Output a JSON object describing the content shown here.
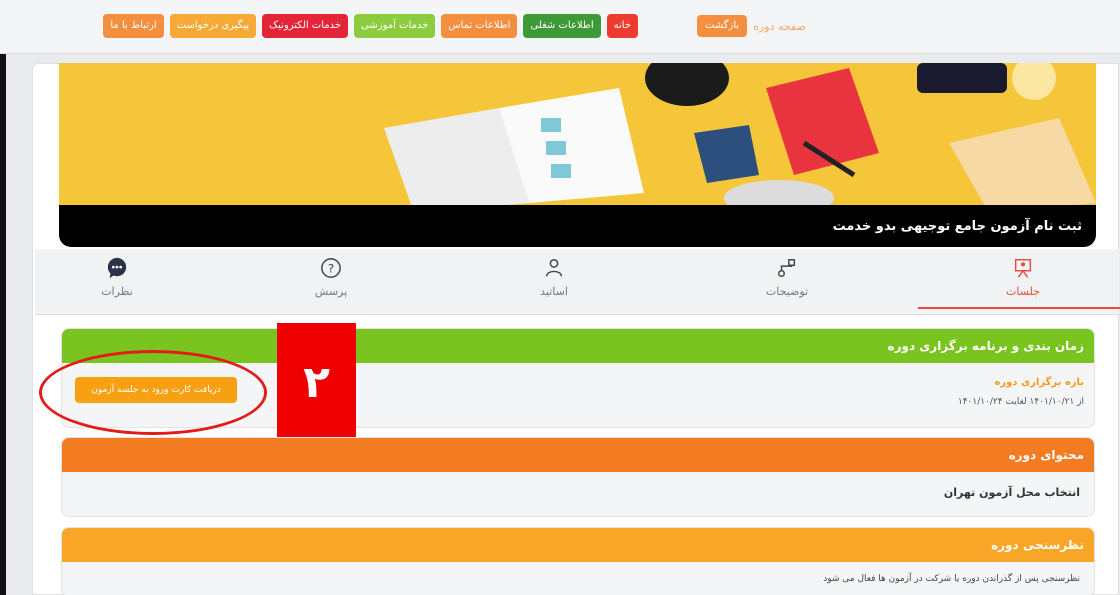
{
  "nav": {
    "items": [
      {
        "label": "خانه",
        "color": "#ee3b2f"
      },
      {
        "label": "اطلاعات شغلی",
        "color": "#3e9a36"
      },
      {
        "label": "اطلاعات تماس",
        "color": "#f58f40"
      },
      {
        "label": "خدمات آموزشی",
        "color": "#8ccd3f"
      },
      {
        "label": "خدمات الکترونیک",
        "color": "#e42437"
      },
      {
        "label": "پیگیری درخواست",
        "color": "#f7a936"
      },
      {
        "label": "ارتباط با ما",
        "color": "#f58f40"
      }
    ]
  },
  "header": {
    "page_title": "صفحه دوره",
    "back_label": "بازگشت"
  },
  "banner": {
    "title": "ثبت نام آزمون جامع توجیهی بدو خدمت"
  },
  "tabs": [
    {
      "label": "جلسات",
      "icon": "presentation-icon",
      "active": true
    },
    {
      "label": "توضیحات",
      "icon": "route-icon",
      "active": false
    },
    {
      "label": "اساتید",
      "icon": "teacher-icon",
      "active": false
    },
    {
      "label": "پرسش",
      "icon": "question-icon",
      "active": false
    },
    {
      "label": "نظرات",
      "icon": "comments-icon",
      "active": false
    }
  ],
  "schedule": {
    "title": "زمان بندی و برنامه برگزاری دوره",
    "period_label": "بازه برگزاری دوره",
    "period_text": "از ۱۴۰۱/۱۰/۲۱ لغایت ۱۴۰۱/۱۰/۲۴",
    "ticket_button": "دریافت کارت ورود به جلسه آزمون"
  },
  "annotation": {
    "marker": "۲"
  },
  "content": {
    "title": "محتوای دوره",
    "item": "انتخاب محل آزمون تهران"
  },
  "survey": {
    "title": "نظرسنجی دوره",
    "text": "نظرسنجی پس از گذراندن دوره یا شرکت در آزمون ها فعال می شود"
  }
}
